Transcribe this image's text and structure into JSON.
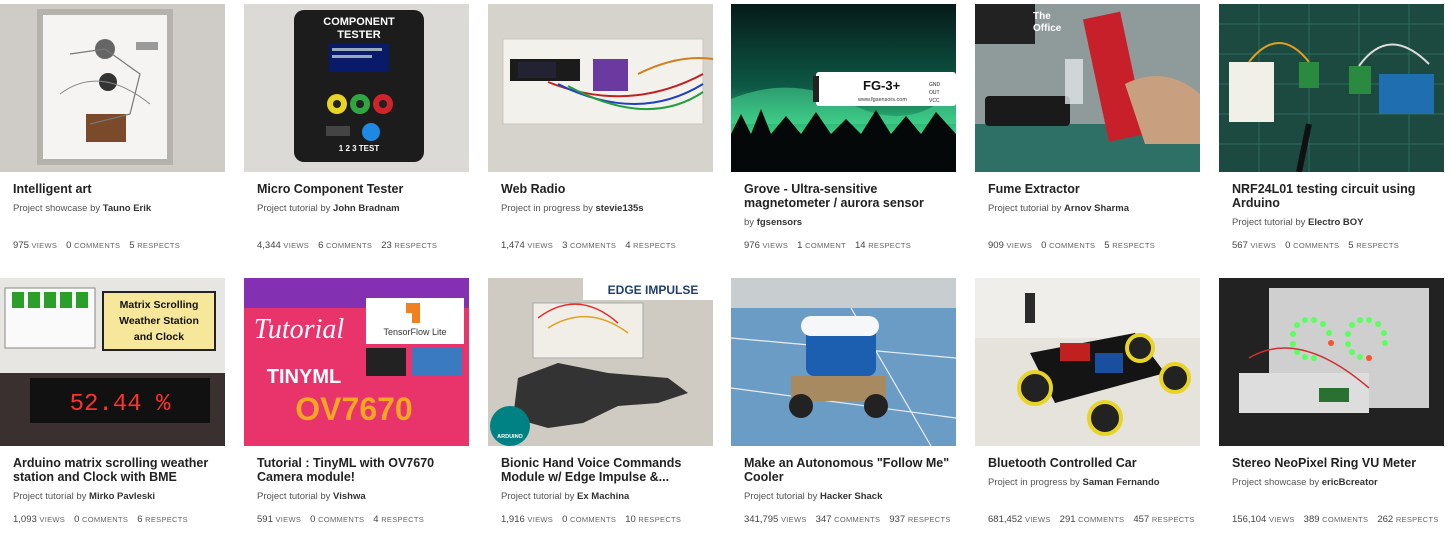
{
  "projects": [
    {
      "title": "Intelligent art",
      "kind": "Project showcase by",
      "author": "Tauno Erik",
      "views": "975",
      "comments": "0",
      "respects": "5",
      "thumb": "art"
    },
    {
      "title": "Micro Component Tester",
      "kind": "Project tutorial by",
      "author": "John Bradnam",
      "views": "4,344",
      "comments": "6",
      "respects": "23",
      "thumb": "tester",
      "overlay_text": "COMPONENT TESTER",
      "overlay_text2": "1 2 3   TEST"
    },
    {
      "title": "Web Radio",
      "kind": "Project in progress by",
      "author": "stevie135s",
      "views": "1,474",
      "comments": "3",
      "respects": "4",
      "thumb": "breadboard"
    },
    {
      "title": "Grove - Ultra-sensitive magnetometer / aurora sensor",
      "kind": "by",
      "author": "fgsensors",
      "views": "976",
      "comments": "1",
      "respects": "14",
      "thumb": "aurora",
      "overlay_text": "FG-3+",
      "overlay_text2": "www.fgsensors.com",
      "overlay_text3": "GND OUT VCC",
      "comments_label": "comment"
    },
    {
      "title": "Fume Extractor",
      "kind": "Project tutorial by",
      "author": "Arnov Sharma",
      "views": "909",
      "comments": "0",
      "respects": "5",
      "thumb": "fume",
      "overlay_text": "The Office"
    },
    {
      "title": "NRF24L01 testing circuit using Arduino",
      "kind": "Project tutorial by",
      "author": "Electro BOY",
      "views": "567",
      "comments": "0",
      "respects": "5",
      "thumb": "nrf"
    },
    {
      "title": "Arduino matrix scrolling weather station and Clock with BME",
      "kind": "Project tutorial by",
      "author": "Mirko Pavleski",
      "views": "1,093",
      "comments": "0",
      "respects": "6",
      "thumb": "matrix",
      "overlay_text": "Matrix Scrolling Weather Station and Clock",
      "overlay_text2": "52.44 %"
    },
    {
      "title": "Tutorial : TinyML with OV7670 Camera module!",
      "kind": "Project tutorial by",
      "author": "Vishwa",
      "views": "591",
      "comments": "0",
      "respects": "4",
      "thumb": "tinyml",
      "overlay_text": "Tutorial",
      "overlay_text2": "TINYML",
      "overlay_text3": "OV7670",
      "overlay_text4": "TensorFlow Lite"
    },
    {
      "title": "Bionic Hand Voice Commands Module w/ Edge Impulse &...",
      "kind": "Project tutorial by",
      "author": "Ex Machina",
      "views": "1,916",
      "comments": "0",
      "respects": "10",
      "thumb": "hand",
      "overlay_text": "EDGE IMPULSE",
      "overlay_text2": "ARDUINO"
    },
    {
      "title": "Make an Autonomous \"Follow Me\" Cooler",
      "kind": "Project tutorial by",
      "author": "Hacker Shack",
      "views": "341,795",
      "comments": "347",
      "respects": "937",
      "thumb": "cooler"
    },
    {
      "title": "Bluetooth Controlled Car",
      "kind": "Project in progress by",
      "author": "Saman Fernando",
      "views": "681,452",
      "comments": "291",
      "respects": "457",
      "thumb": "car"
    },
    {
      "title": "Stereo NeoPixel Ring VU Meter",
      "kind": "Project showcase by",
      "author": "ericBcreator",
      "views": "156,104",
      "comments": "389",
      "respects": "262",
      "thumb": "neopixel"
    }
  ],
  "labels": {
    "views": "views",
    "comments": "comments",
    "comment": "comment",
    "respects": "respects"
  },
  "colors": {
    "title": "#222222",
    "meta": "#555555",
    "auroraGreen": "#3be08a",
    "tinymlPink": "#e8346b",
    "edgeBlue": "#1e3f73"
  }
}
